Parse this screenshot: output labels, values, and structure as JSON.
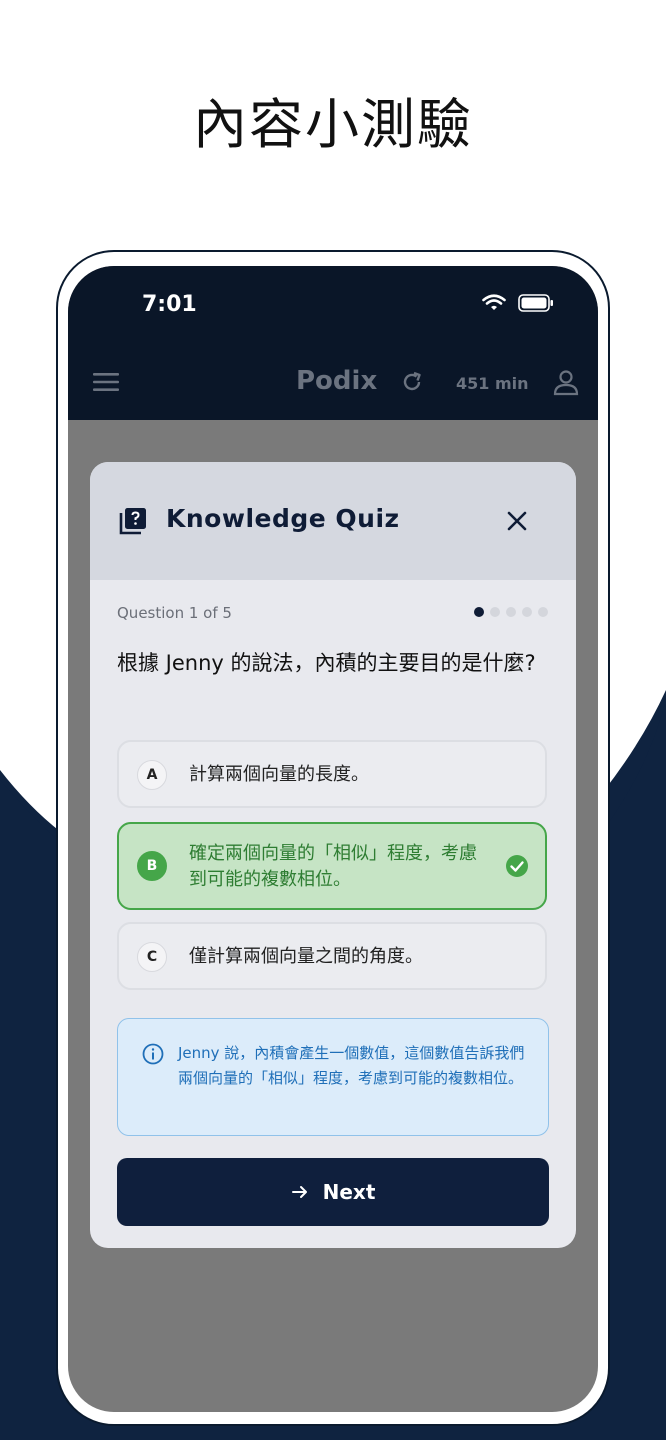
{
  "headline": "內容小測驗",
  "status": {
    "time": "7:01"
  },
  "app": {
    "title": "Podix",
    "minutes": "451 min"
  },
  "modal": {
    "title": "Knowledge Quiz",
    "question_counter": "Question 1 of 5",
    "progress": {
      "current": 1,
      "total": 5
    },
    "question": "根據 Jenny 的說法，內積的主要目的是什麼?",
    "options": [
      {
        "letter": "A",
        "text": "計算兩個向量的長度。",
        "state": "default"
      },
      {
        "letter": "B",
        "text": "確定兩個向量的「相似」程度，考慮到可能的複數相位。",
        "state": "correct"
      },
      {
        "letter": "C",
        "text": "僅計算兩個向量之間的角度。",
        "state": "default"
      }
    ],
    "explanation": "Jenny 說，內積會產生一個數值，這個數值告訴我們兩個向量的「相似」程度，考慮到可能的複數相位。",
    "next_label": "Next"
  },
  "colors": {
    "navy": "#0f2340",
    "correct_green": "#45a649",
    "info_blue": "#1f6fb8"
  },
  "icons": [
    "menu-icon",
    "refresh-icon",
    "user-icon",
    "quiz-icon",
    "close-icon",
    "check-circle-icon",
    "info-icon",
    "arrow-right-icon",
    "wifi-icon",
    "battery-icon"
  ]
}
